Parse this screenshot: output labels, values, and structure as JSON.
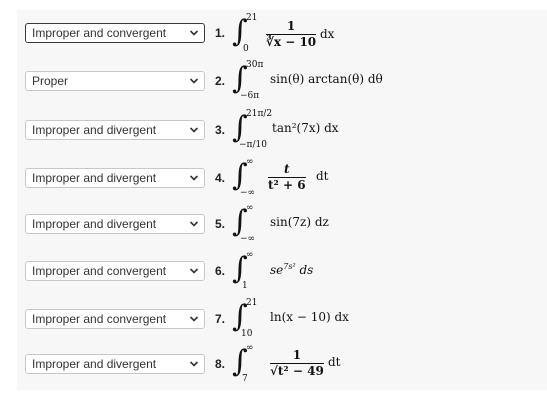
{
  "problems": [
    {
      "number": "1.",
      "selected": "Improper and convergent",
      "upper": "21",
      "lower": "0",
      "numerator": "1",
      "denominator": "∛x − 10",
      "differential": "dx"
    },
    {
      "number": "2.",
      "selected": "Proper",
      "upper": "30π",
      "lower": "−6π",
      "integrand": "sin(θ) arctan(θ) dθ"
    },
    {
      "number": "3.",
      "selected": "Improper and divergent",
      "upper": "21π/2",
      "lower": "−π/10",
      "integrand": "tan²(7x) dx"
    },
    {
      "number": "4.",
      "selected": "Improper and divergent",
      "upper": "∞",
      "lower": "−∞",
      "numerator": "t",
      "denominator": "t² + 6",
      "differential": "dt"
    },
    {
      "number": "5.",
      "selected": "Improper and divergent",
      "upper": "∞",
      "lower": "−∞",
      "integrand": "sin(7z) dz"
    },
    {
      "number": "6.",
      "selected": "Improper and convergent",
      "upper": "∞",
      "lower": "1",
      "integrand": "se",
      "exponent": "7s²",
      "differential": " ds"
    },
    {
      "number": "7.",
      "selected": "Improper and convergent",
      "upper": "21",
      "lower": "10",
      "integrand": "ln(x − 10) dx"
    },
    {
      "number": "8.",
      "selected": "Improper and divergent",
      "upper": "∞",
      "lower": "7",
      "numerator": "1",
      "denominator": "√t² − 49",
      "differential": "dt"
    }
  ],
  "icons": {
    "dropdown": "chevron-down-icon"
  },
  "colors": {
    "panel_bg": "#f7f7f7",
    "border": "#c8c8c8",
    "focus_border": "#3a3a3a"
  }
}
